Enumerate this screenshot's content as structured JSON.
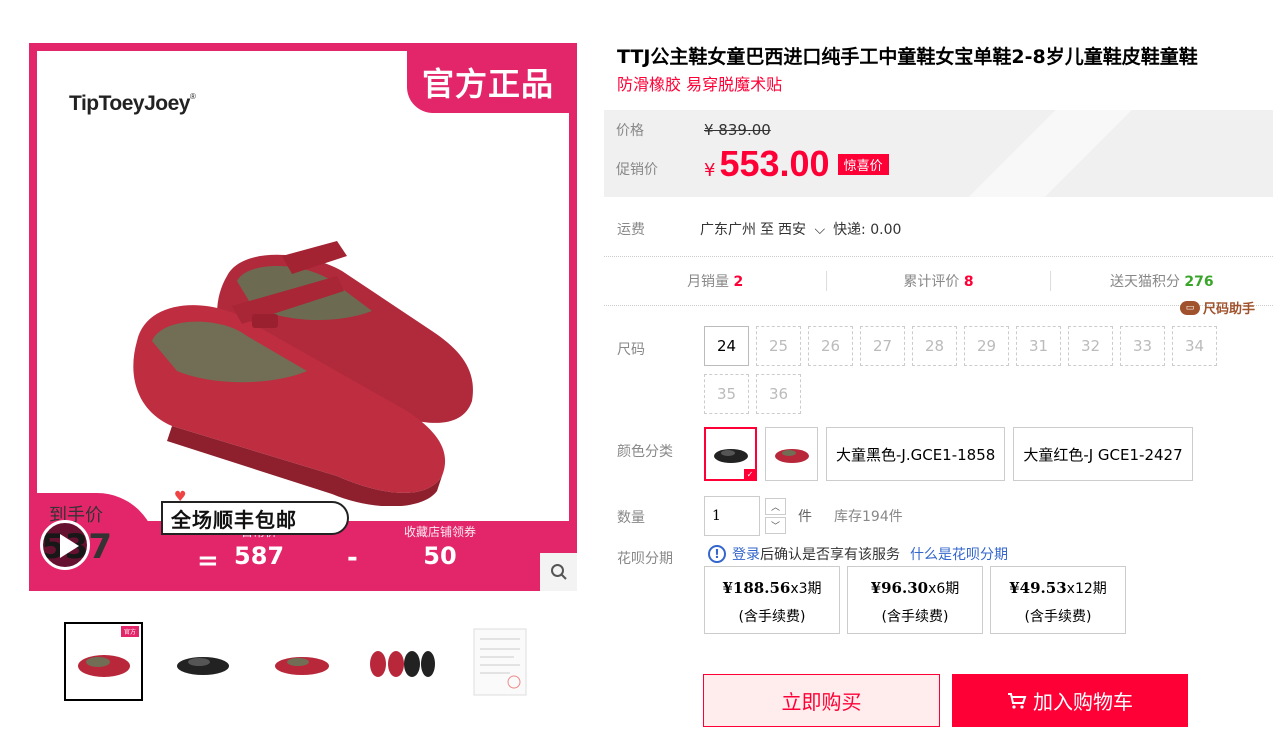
{
  "gallery": {
    "brand": "TipToeyJoey",
    "official_tag": "官方正品",
    "promo_ribbon": "全场顺丰包邮",
    "final_price_label": "到手价",
    "final_price_value": "537",
    "equals": "=",
    "regular_label": "日常价",
    "regular_value": "587",
    "minus": "-",
    "coupon_label": "收藏店铺领券",
    "coupon_value": "50"
  },
  "product": {
    "title": "TTJ公主鞋女童巴西进口纯手工中童鞋女宝单鞋2-8岁儿童鞋皮鞋童鞋",
    "subtitle": "防滑橡胶 易穿脱魔术贴"
  },
  "price": {
    "original_label": "价格",
    "original": "¥ 839.00",
    "promo_label": "促销价",
    "currency": "¥",
    "promo": "553.00",
    "promo_tag": "惊喜价"
  },
  "shipping": {
    "label": "运费",
    "from": "广东广州",
    "to_word": "至",
    "to": "西安",
    "express": "快递: 0.00"
  },
  "stats": {
    "monthly_label": "月销量",
    "monthly": "2",
    "reviews_label": "累计评价",
    "reviews": "8",
    "points_label": "送天猫积分",
    "points": "276",
    "size_helper": "尺码助手"
  },
  "size": {
    "label": "尺码",
    "options": [
      "24",
      "25",
      "26",
      "27",
      "28",
      "29",
      "31",
      "32",
      "33",
      "34",
      "35",
      "36"
    ],
    "selected": "24"
  },
  "color": {
    "label": "颜色分类",
    "text_options": [
      "大童黑色-J.GCE1-1858",
      "大童红色-J GCE1-2427"
    ]
  },
  "quantity": {
    "label": "数量",
    "value": "1",
    "unit": "件",
    "stock": "库存194件"
  },
  "installment": {
    "label": "花呗分期",
    "login": "登录",
    "note": "后确认是否享有该服务",
    "what": "什么是花呗分期",
    "plans": [
      {
        "amount": "¥188.56",
        "periods": "x3期",
        "fee": "(含手续费)"
      },
      {
        "amount": "¥96.30",
        "periods": "x6期",
        "fee": "(含手续费)"
      },
      {
        "amount": "¥49.53",
        "periods": "x12期",
        "fee": "(含手续费)"
      }
    ]
  },
  "actions": {
    "buy_now": "立即购买",
    "add_cart": "加入购物车"
  },
  "colors": {
    "accent": "#ff0036",
    "gallery_pink": "#e3266a",
    "shoe_red": "#b8283a"
  }
}
